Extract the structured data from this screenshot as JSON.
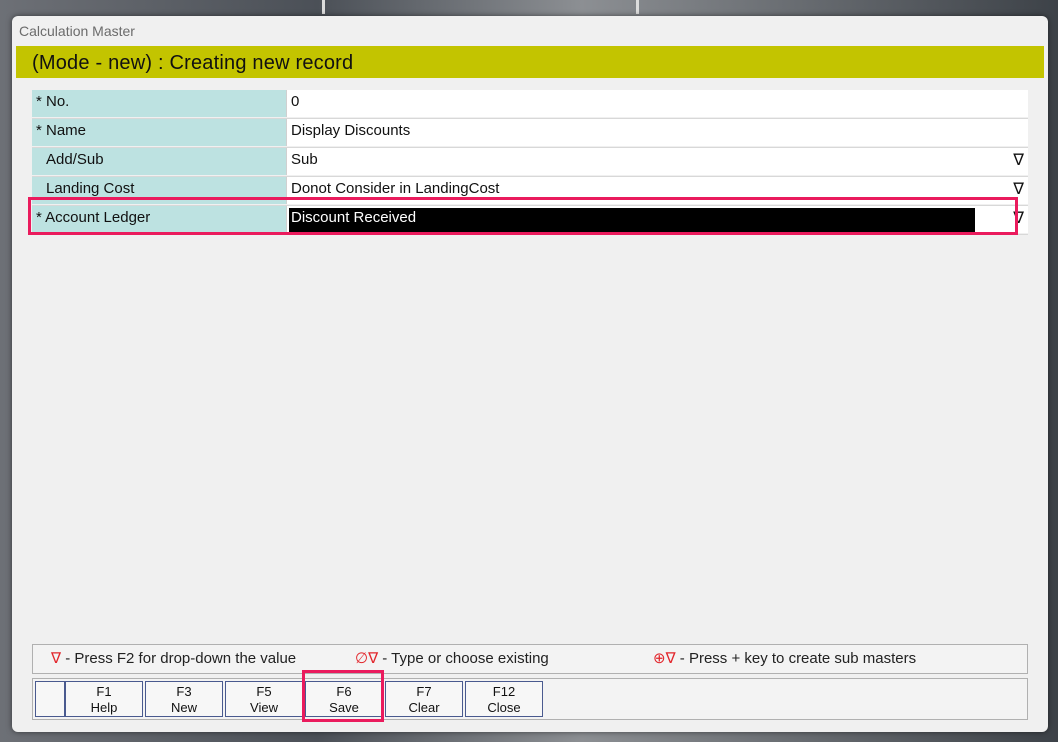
{
  "window": {
    "title": "Calculation Master"
  },
  "mode_banner": "(Mode - new) : Creating new record",
  "fields": [
    {
      "label": "* No.",
      "value": "0"
    },
    {
      "label": "* Name",
      "value": "Display Discounts"
    },
    {
      "label": "Add/Sub",
      "value": "Sub",
      "dropdown": "∇"
    },
    {
      "label": "Landing Cost",
      "value": "Donot Consider in LandingCost",
      "dropdown": "∇"
    },
    {
      "label": "* Account Ledger",
      "value": "Discount Received",
      "dropdown": "∇"
    }
  ],
  "legend": {
    "dropdown_icon": "∇",
    "dropdown_text": " - Press F2 for drop-down the value",
    "type_icon": "∅∇",
    "type_text": " - Type or choose existing",
    "create_icon": "⊕∇",
    "create_text": " - Press + key to create sub masters"
  },
  "function_keys": [
    {
      "key": "F1",
      "label": "Help"
    },
    {
      "key": "F3",
      "label": "New"
    },
    {
      "key": "F5",
      "label": "View"
    },
    {
      "key": "F6",
      "label": "Save"
    },
    {
      "key": "F7",
      "label": "Clear"
    },
    {
      "key": "F12",
      "label": "Close"
    }
  ],
  "colors": {
    "mode_banner": "#c3c400",
    "label_bg": "#bde2e1",
    "highlight": "#ea1b5d"
  }
}
